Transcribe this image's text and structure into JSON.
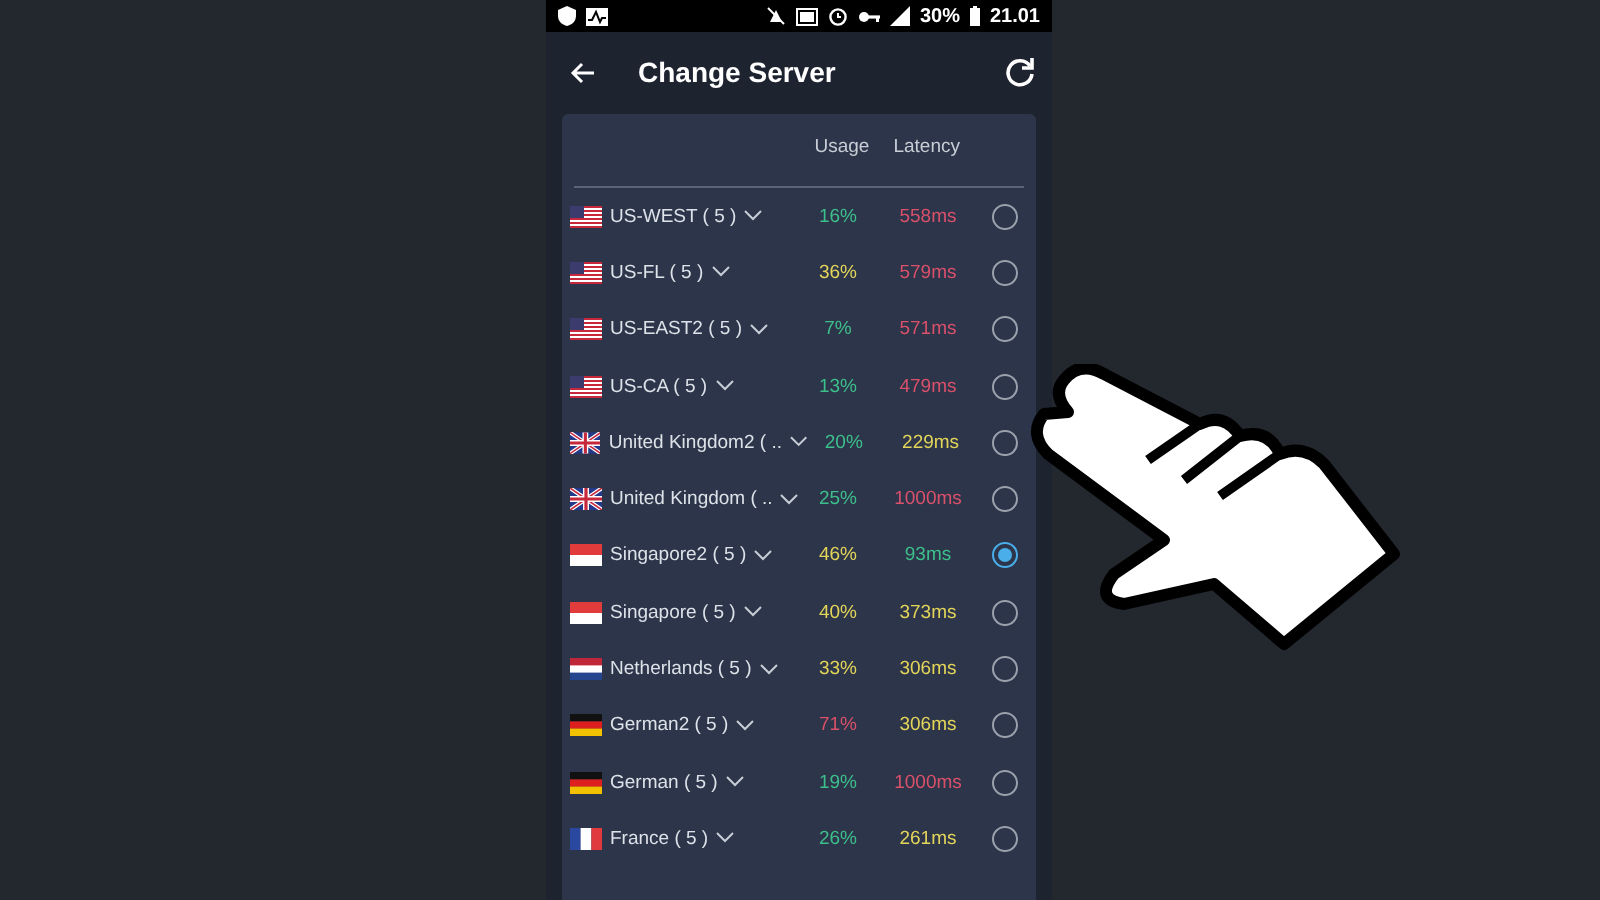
{
  "status_bar": {
    "battery": "30%",
    "time": "21.01"
  },
  "header": {
    "title": "Change Server"
  },
  "table": {
    "columns": [
      "Usage",
      "Latency"
    ],
    "rows": [
      {
        "kind": "us",
        "name": "US-WEST ( 5 )",
        "usage": {
          "text": "16%",
          "color": "#3dbf8c"
        },
        "latency": {
          "text": "558ms",
          "color": "#d9506b"
        },
        "selected": false
      },
      {
        "kind": "us",
        "name": "US-FL ( 5 )",
        "usage": {
          "text": "36%",
          "color": "#e3d45a"
        },
        "latency": {
          "text": "579ms",
          "color": "#d9506b"
        },
        "selected": false
      },
      {
        "kind": "us",
        "name": "US-EAST2 ( 5 )",
        "usage": {
          "text": "7%",
          "color": "#3dbf8c"
        },
        "latency": {
          "text": "571ms",
          "color": "#d9506b"
        },
        "selected": false
      },
      {
        "kind": "us",
        "name": "US-CA ( 5 )",
        "usage": {
          "text": "13%",
          "color": "#3dbf8c"
        },
        "latency": {
          "text": "479ms",
          "color": "#d9506b"
        },
        "selected": false
      },
      {
        "kind": "uk",
        "name": "United Kingdom2 ( ..",
        "usage": {
          "text": "20%",
          "color": "#3dbf8c"
        },
        "latency": {
          "text": "229ms",
          "color": "#e3d45a"
        },
        "selected": false
      },
      {
        "kind": "uk",
        "name": "United Kingdom ( ..",
        "usage": {
          "text": "25%",
          "color": "#3dbf8c"
        },
        "latency": {
          "text": "1000ms",
          "color": "#d9506b"
        },
        "selected": false
      },
      {
        "kind": "sg",
        "name": "Singapore2 ( 5 )",
        "usage": {
          "text": "46%",
          "color": "#e3d45a"
        },
        "latency": {
          "text": "93ms",
          "color": "#3dbf8c"
        },
        "selected": true
      },
      {
        "kind": "sg",
        "name": "Singapore ( 5 )",
        "usage": {
          "text": "40%",
          "color": "#e3d45a"
        },
        "latency": {
          "text": "373ms",
          "color": "#e3d45a"
        },
        "selected": false
      },
      {
        "kind": "nl",
        "name": "Netherlands ( 5 )",
        "usage": {
          "text": "33%",
          "color": "#e3d45a"
        },
        "latency": {
          "text": "306ms",
          "color": "#e3d45a"
        },
        "selected": false
      },
      {
        "kind": "de",
        "name": "German2 ( 5 )",
        "usage": {
          "text": "71%",
          "color": "#d9506b"
        },
        "latency": {
          "text": "306ms",
          "color": "#e3d45a"
        },
        "selected": false
      },
      {
        "kind": "de",
        "name": "German ( 5 )",
        "usage": {
          "text": "19%",
          "color": "#3dbf8c"
        },
        "latency": {
          "text": "1000ms",
          "color": "#d9506b"
        },
        "selected": false
      },
      {
        "kind": "fr",
        "name": "France ( 5 )",
        "usage": {
          "text": "26%",
          "color": "#3dbf8c"
        },
        "latency": {
          "text": "261ms",
          "color": "#e3d45a"
        },
        "selected": false
      }
    ]
  }
}
